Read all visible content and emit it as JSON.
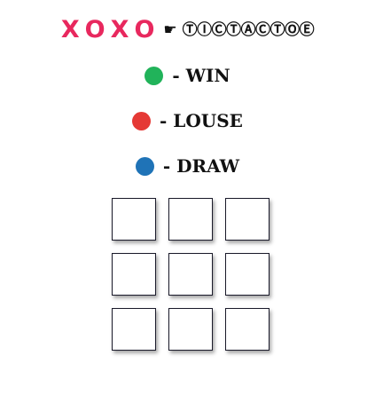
{
  "header": {
    "x1": "X",
    "o1": "O",
    "x2": "X",
    "o2": "O",
    "pointer_icon": "☛",
    "circled_text": "ⓉⒾⒸⓉⒶⒸⓉⓄⒺ"
  },
  "colors": {
    "x_mark": "#e8285e",
    "o_mark": "#e8285e",
    "win": "#21b35a",
    "lose": "#e53935",
    "draw": "#1f73b7",
    "cell_border": "#1a1a2a"
  },
  "legend": {
    "win": {
      "label": "- WIN",
      "color": "#21b35a"
    },
    "lose": {
      "label": "- LOUSE",
      "color": "#e53935"
    },
    "draw": {
      "label": "- DRAW",
      "color": "#1f73b7"
    }
  },
  "board": {
    "rows": 3,
    "cols": 3,
    "cells": [
      "",
      "",
      "",
      "",
      "",
      "",
      "",
      "",
      ""
    ]
  }
}
